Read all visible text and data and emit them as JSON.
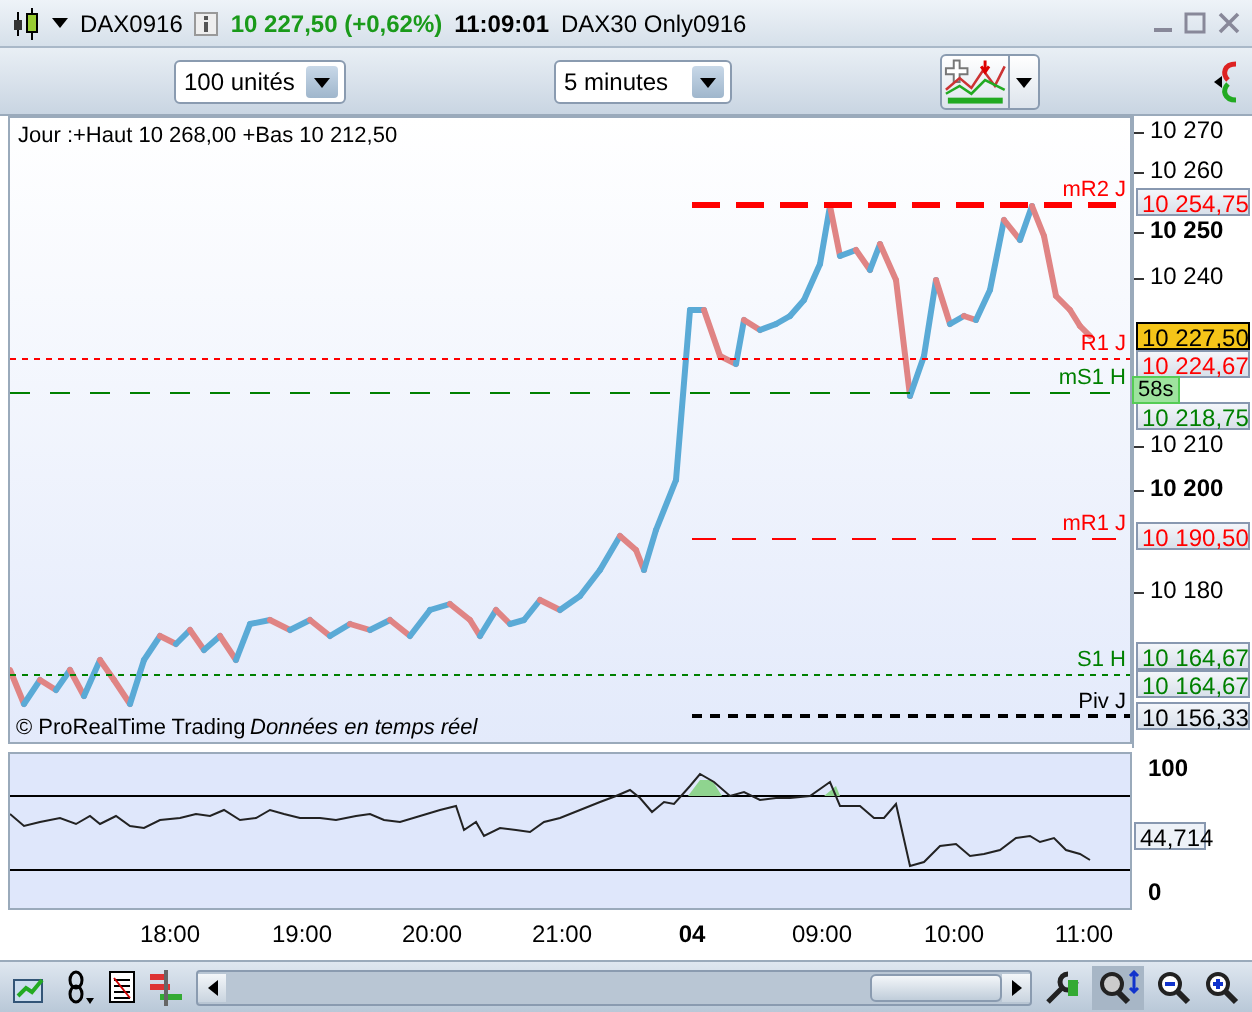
{
  "header": {
    "symbol": "DAX0916",
    "price_change": "10 227,50 (+0,62%)",
    "time": "11:09:01",
    "name": "DAX30 Only0916"
  },
  "toolbar": {
    "quantity": "100 unités",
    "period": "5 minutes"
  },
  "chart": {
    "info": "Jour :+Haut 10 268,00 +Bas 10 212,50",
    "copyright": "© ProRealTime Trading",
    "realtime": "Données en temps réel",
    "levels": [
      {
        "label": "mR2 J",
        "color": "#ff0000"
      },
      {
        "label": "R1 J",
        "color": "#ff0000"
      },
      {
        "label": "mS1 H",
        "color": "#008000"
      },
      {
        "label": "mR1 J",
        "color": "#ff0000"
      },
      {
        "label": "S1 H",
        "color": "#008000"
      },
      {
        "label": "Piv J",
        "color": "#000000"
      }
    ],
    "price_ticks": [
      {
        "text": "10 270",
        "major": false
      },
      {
        "text": "10 260",
        "major": false
      },
      {
        "text": "10 250",
        "major": true
      },
      {
        "text": "10 240",
        "major": false
      },
      {
        "text": "10 210",
        "major": false
      },
      {
        "text": "10 200",
        "major": true
      },
      {
        "text": "10 180",
        "major": false
      }
    ],
    "price_boxes": [
      {
        "text": "10 254,75",
        "color": "#ff0000"
      },
      {
        "text": "10 227,50",
        "color": "#000000"
      },
      {
        "text": "10 224,67",
        "color": "#ff0000"
      },
      {
        "text": "10 218,75",
        "color": "#008000"
      },
      {
        "text": "10 190,50",
        "color": "#ff0000"
      },
      {
        "text": "10 164,67",
        "color": "#008000"
      },
      {
        "text": "10 164,67",
        "color": "#008000"
      },
      {
        "text": "10 156,33",
        "color": "#000000"
      }
    ],
    "countdown": "58s"
  },
  "indicator": {
    "ticks": [
      "100",
      "0"
    ],
    "value": "44,714"
  },
  "time_axis": [
    {
      "text": "18:00",
      "major": false
    },
    {
      "text": "19:00",
      "major": false
    },
    {
      "text": "20:00",
      "major": false
    },
    {
      "text": "21:00",
      "major": false
    },
    {
      "text": "04",
      "major": true
    },
    {
      "text": "09:00",
      "major": false
    },
    {
      "text": "10:00",
      "major": false
    },
    {
      "text": "11:00",
      "major": false
    }
  ]
}
